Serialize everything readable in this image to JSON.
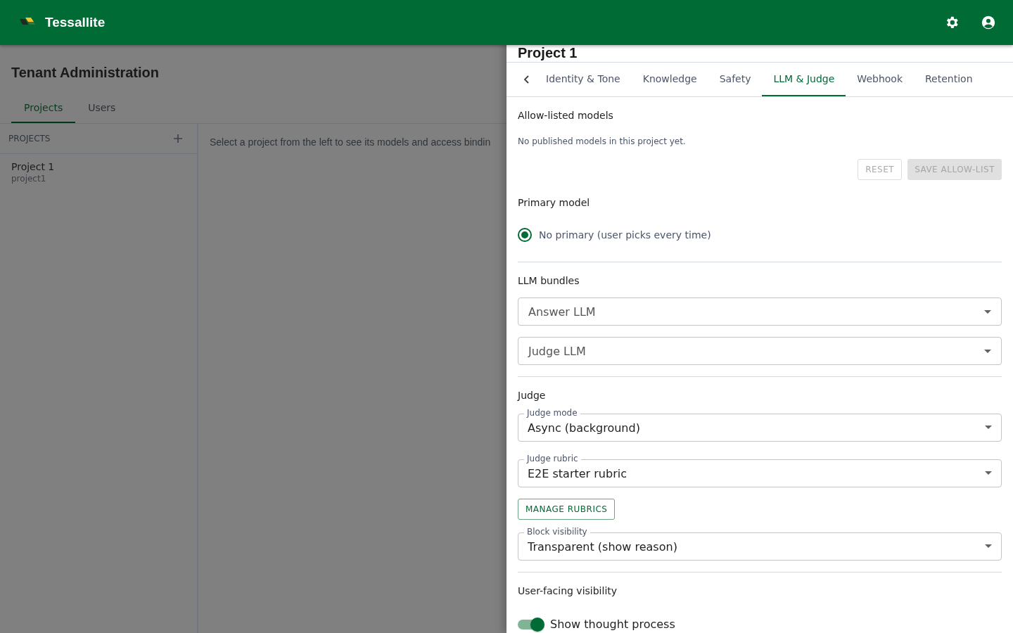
{
  "app_bar": {
    "title": "Tessallite"
  },
  "page": {
    "title": "Tenant Administration",
    "tabs": [
      {
        "label": "Projects",
        "selected": true
      },
      {
        "label": "Users",
        "selected": false
      }
    ],
    "projects_panel": {
      "heading": "PROJECTS",
      "items": [
        {
          "name": "Project 1",
          "slug": "project1"
        }
      ]
    },
    "hint": "Select a project from the left to see its models and access bindin"
  },
  "drawer": {
    "title": "Project 1",
    "tabs": [
      {
        "label": "Identity & Tone",
        "selected": false
      },
      {
        "label": "Knowledge",
        "selected": false
      },
      {
        "label": "Safety",
        "selected": false
      },
      {
        "label": "LLM & Judge",
        "selected": true
      },
      {
        "label": "Webhook",
        "selected": false
      },
      {
        "label": "Retention",
        "selected": false
      }
    ],
    "allow_list": {
      "heading": "Allow-listed models",
      "empty_text": "No published models in this project yet.",
      "buttons": [
        {
          "label": "RESET",
          "kind": "outlined",
          "disabled": true
        },
        {
          "label": "SAVE ALLOW-LIST",
          "kind": "filled",
          "disabled": true
        }
      ]
    },
    "primary_model": {
      "heading": "Primary model",
      "options": [
        {
          "label": "No primary (user picks every time)",
          "selected": true
        }
      ]
    },
    "llm_bundles": {
      "heading": "LLM bundles",
      "selects": [
        {
          "placeholder": "Answer LLM"
        },
        {
          "placeholder": "Judge LLM"
        }
      ]
    },
    "judge": {
      "heading": "Judge",
      "selects": [
        {
          "label": "Judge mode",
          "value": "Async (background)"
        },
        {
          "label": "Judge rubric",
          "value": "E2E starter rubric"
        }
      ],
      "manage_button": "MANAGE RUBRICS",
      "block_visibility": {
        "label": "Block visibility",
        "value": "Transparent (show reason)"
      }
    },
    "user_visibility": {
      "heading": "User-facing visibility",
      "toggles": [
        {
          "label": "Show thought process",
          "on": true
        }
      ]
    }
  }
}
